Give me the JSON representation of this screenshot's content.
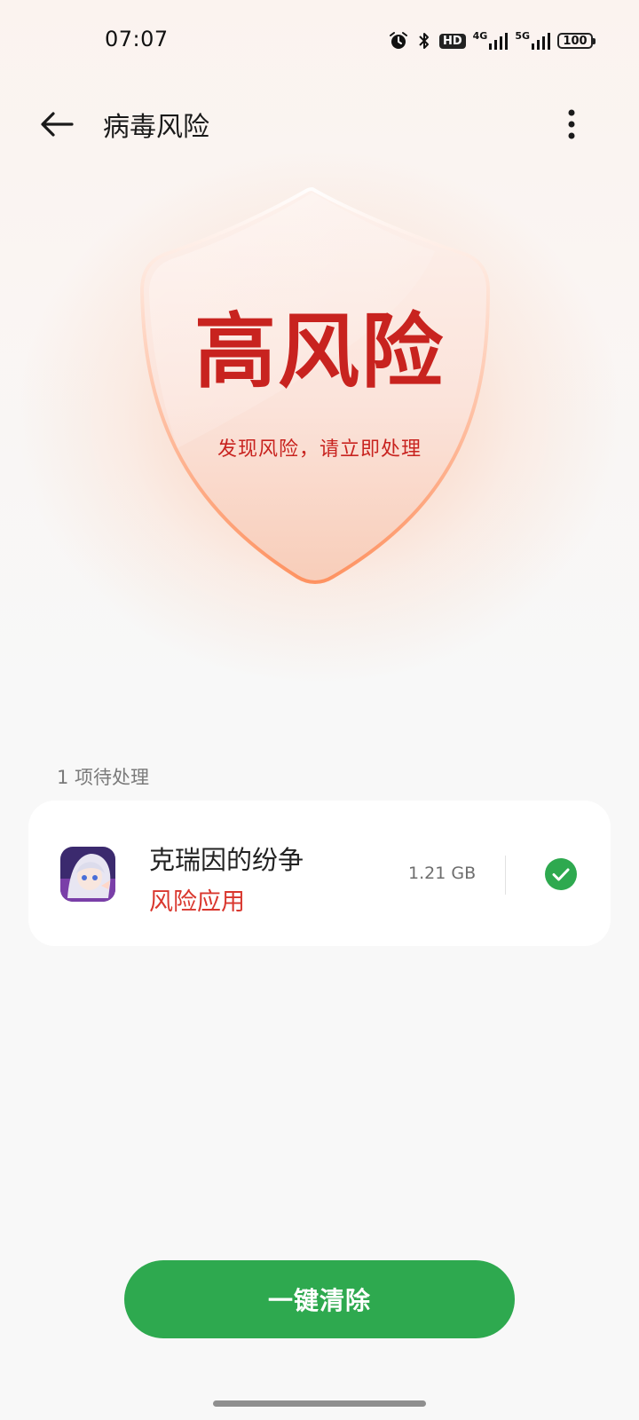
{
  "status_bar": {
    "time": "07:07",
    "hd_label": "HD",
    "net1_label": "4G",
    "net2_label": "5G",
    "battery": "100"
  },
  "header": {
    "title": "病毒风险"
  },
  "shield": {
    "title": "高风险",
    "subtitle": "发现风险，请立即处理"
  },
  "pending": {
    "label": "1 项待处理",
    "items": [
      {
        "name": "克瑞因的纷争",
        "risk_label": "风险应用",
        "size": "1.21 GB",
        "checked": true
      }
    ]
  },
  "actions": {
    "clean_label": "一键清除"
  },
  "colors": {
    "risk_red": "#c8231f",
    "accent_green": "#2ea94f",
    "shield_glow": "#ff8246"
  }
}
